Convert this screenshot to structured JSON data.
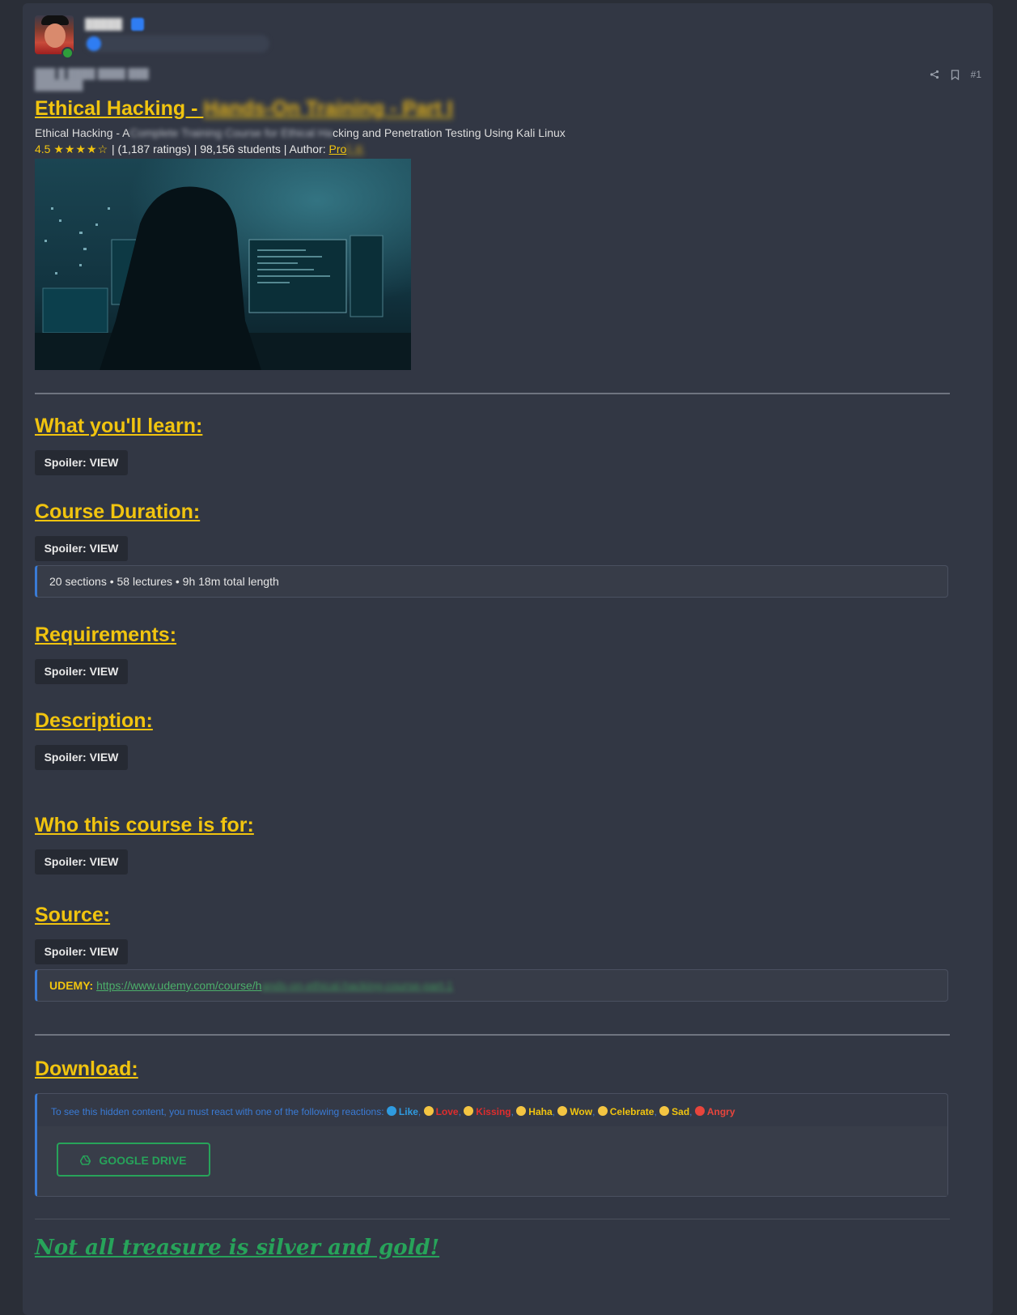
{
  "post": {
    "username": "█████",
    "user_title": "█ ██ ███████ ██ ███████",
    "date": "███ █ ████ ████ ███ ███████",
    "post_number": "#1"
  },
  "course": {
    "title_visible": "Ethical Hacking - ",
    "title_hidden": "Hands-On Training - Part I",
    "subtitle_start": "Ethical Hacking - A",
    "subtitle_hidden": "Complete Training Course for Ethical Ha",
    "subtitle_end": "cking and Penetration Testing Using Kali Linux",
    "rating": "4.5",
    "stars": "★★★★☆",
    "ratings_text": "| (1,187 ratings) | 98,156 students | Author: ",
    "author_visible": "Pro",
    "author_hidden": "f. K"
  },
  "sections": {
    "learn": {
      "heading": "What you'll learn:",
      "spoiler": "Spoiler: VIEW"
    },
    "duration": {
      "heading": "Course Duration:",
      "spoiler": "Spoiler: VIEW",
      "info": "20 sections • 58 lectures • 9h 18m total length"
    },
    "requirements": {
      "heading": "Requirements:",
      "spoiler": "Spoiler: VIEW"
    },
    "description": {
      "heading": "Description:",
      "spoiler": "Spoiler: VIEW"
    },
    "audience": {
      "heading": "Who this course is for:",
      "spoiler": "Spoiler: VIEW"
    },
    "source": {
      "heading": "Source:",
      "spoiler": "Spoiler: VIEW",
      "label": "UDEMY:",
      "url_visible": "https://www.udemy.com/course/h",
      "url_hidden": "ands-on-ethical-hacking-course-part-1"
    }
  },
  "download": {
    "heading": "Download:",
    "hidden_text": "To see this hidden content, you must react with one of the following reactions: ",
    "reactions": [
      "Like",
      "Love",
      "Kissing",
      "Haha",
      "Wow",
      "Celebrate",
      "Sad",
      "Angry"
    ],
    "button": "GOOGLE DRIVE"
  },
  "motto": "Not all treasure is silver and gold!",
  "colors": {
    "accent": "#f1c40f",
    "link_green": "#27a35a",
    "quote_border": "#3a7bd5",
    "background": "#323744"
  },
  "icons": [
    "share-icon",
    "bookmark-icon",
    "google-drive-icon"
  ]
}
